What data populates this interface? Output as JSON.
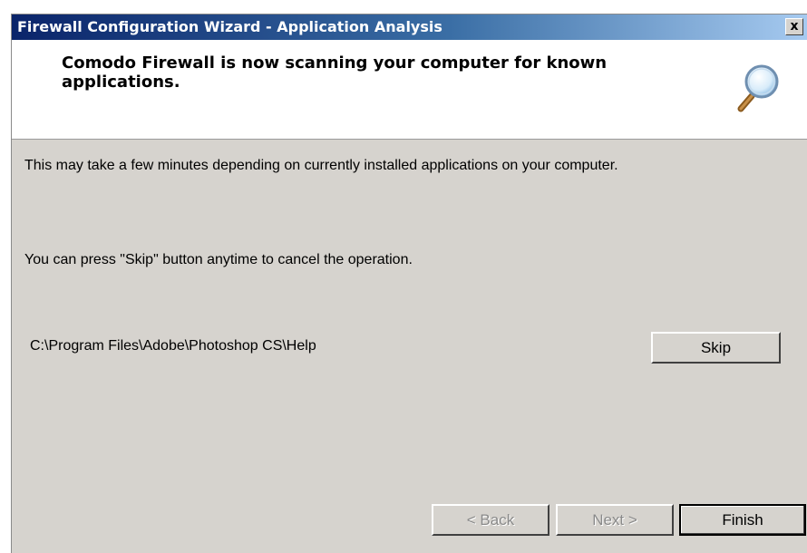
{
  "window": {
    "title": "Firewall Configuration Wizard - Application Analysis",
    "close_label": "x"
  },
  "header": {
    "message": "Comodo Firewall is now scanning your computer for known applications.",
    "icon": "magnifier-icon"
  },
  "body": {
    "info_text": "This  may take a few  minutes depending on currently installed applications on your computer.",
    "skip_text": "You can press \"Skip\" button anytime to cancel the operation.",
    "current_path": "C:\\Program Files\\Adobe\\Photoshop CS\\Help"
  },
  "buttons": {
    "skip": "Skip",
    "back": "< Back",
    "next": "Next >",
    "finish": "Finish"
  }
}
